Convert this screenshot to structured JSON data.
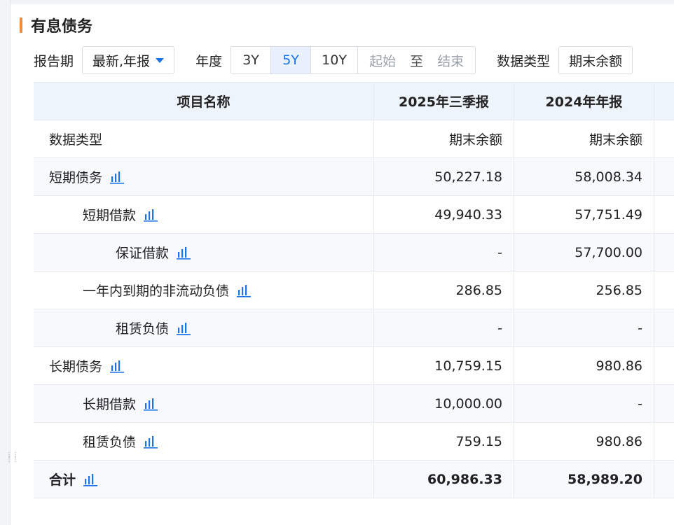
{
  "title": "有息债务",
  "filters": {
    "period_label": "报告期",
    "period_value": "最新,年报",
    "year_label": "年度",
    "year_options": [
      "3Y",
      "5Y",
      "10Y"
    ],
    "year_selected": "5Y",
    "range_start": "起始",
    "range_to": "至",
    "range_end": "结束",
    "datatype_label": "数据类型",
    "datatype_value": "期末余额"
  },
  "colors": {
    "accent": "#1a73e8",
    "title_bar": "#f08c3a",
    "header_bg": "#eef4fb"
  },
  "table": {
    "headers": [
      "项目名称",
      "2025年三季报",
      "2024年年报"
    ],
    "rows": [
      {
        "name": "数据类型",
        "v1": "期末余额",
        "v2": "期末余额",
        "icon": false
      },
      {
        "name": "短期债务",
        "v1": "50,227.18",
        "v2": "58,008.34",
        "icon": "bar-chart-icon"
      },
      {
        "name": "短期借款",
        "v1": "49,940.33",
        "v2": "57,751.49",
        "icon": "bar-chart-icon"
      },
      {
        "name": "保证借款",
        "v1": "-",
        "v2": "57,700.00",
        "icon": "bar-chart-icon"
      },
      {
        "name": "一年内到期的非流动负债",
        "v1": "286.85",
        "v2": "256.85",
        "icon": "bar-chart-icon"
      },
      {
        "name": "租赁负债",
        "v1": "-",
        "v2": "-",
        "icon": "bar-chart-icon"
      },
      {
        "name": "长期债务",
        "v1": "10,759.15",
        "v2": "980.86",
        "icon": "bar-chart-icon"
      },
      {
        "name": "长期借款",
        "v1": "10,000.00",
        "v2": "-",
        "icon": "bar-chart-icon"
      },
      {
        "name": "租赁负债",
        "v1": "759.15",
        "v2": "980.86",
        "icon": "bar-chart-icon"
      },
      {
        "name": "合计",
        "v1": "60,986.33",
        "v2": "58,989.20",
        "icon": "bar-chart-icon"
      }
    ]
  }
}
